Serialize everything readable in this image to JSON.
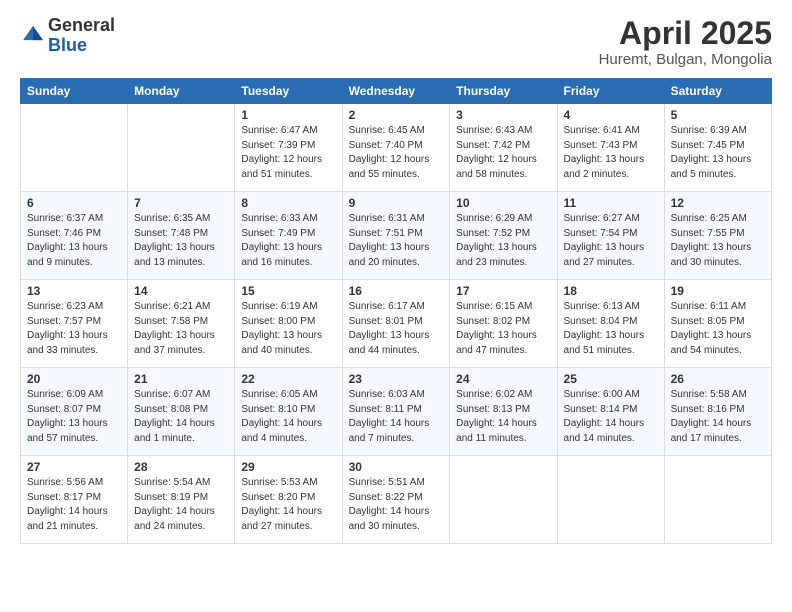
{
  "logo": {
    "general": "General",
    "blue": "Blue"
  },
  "title": "April 2025",
  "location": "Huremt, Bulgan, Mongolia",
  "days_of_week": [
    "Sunday",
    "Monday",
    "Tuesday",
    "Wednesday",
    "Thursday",
    "Friday",
    "Saturday"
  ],
  "weeks": [
    [
      {
        "day": "",
        "info": ""
      },
      {
        "day": "",
        "info": ""
      },
      {
        "day": "1",
        "info": "Sunrise: 6:47 AM\nSunset: 7:39 PM\nDaylight: 12 hours and 51 minutes."
      },
      {
        "day": "2",
        "info": "Sunrise: 6:45 AM\nSunset: 7:40 PM\nDaylight: 12 hours and 55 minutes."
      },
      {
        "day": "3",
        "info": "Sunrise: 6:43 AM\nSunset: 7:42 PM\nDaylight: 12 hours and 58 minutes."
      },
      {
        "day": "4",
        "info": "Sunrise: 6:41 AM\nSunset: 7:43 PM\nDaylight: 13 hours and 2 minutes."
      },
      {
        "day": "5",
        "info": "Sunrise: 6:39 AM\nSunset: 7:45 PM\nDaylight: 13 hours and 5 minutes."
      }
    ],
    [
      {
        "day": "6",
        "info": "Sunrise: 6:37 AM\nSunset: 7:46 PM\nDaylight: 13 hours and 9 minutes."
      },
      {
        "day": "7",
        "info": "Sunrise: 6:35 AM\nSunset: 7:48 PM\nDaylight: 13 hours and 13 minutes."
      },
      {
        "day": "8",
        "info": "Sunrise: 6:33 AM\nSunset: 7:49 PM\nDaylight: 13 hours and 16 minutes."
      },
      {
        "day": "9",
        "info": "Sunrise: 6:31 AM\nSunset: 7:51 PM\nDaylight: 13 hours and 20 minutes."
      },
      {
        "day": "10",
        "info": "Sunrise: 6:29 AM\nSunset: 7:52 PM\nDaylight: 13 hours and 23 minutes."
      },
      {
        "day": "11",
        "info": "Sunrise: 6:27 AM\nSunset: 7:54 PM\nDaylight: 13 hours and 27 minutes."
      },
      {
        "day": "12",
        "info": "Sunrise: 6:25 AM\nSunset: 7:55 PM\nDaylight: 13 hours and 30 minutes."
      }
    ],
    [
      {
        "day": "13",
        "info": "Sunrise: 6:23 AM\nSunset: 7:57 PM\nDaylight: 13 hours and 33 minutes."
      },
      {
        "day": "14",
        "info": "Sunrise: 6:21 AM\nSunset: 7:58 PM\nDaylight: 13 hours and 37 minutes."
      },
      {
        "day": "15",
        "info": "Sunrise: 6:19 AM\nSunset: 8:00 PM\nDaylight: 13 hours and 40 minutes."
      },
      {
        "day": "16",
        "info": "Sunrise: 6:17 AM\nSunset: 8:01 PM\nDaylight: 13 hours and 44 minutes."
      },
      {
        "day": "17",
        "info": "Sunrise: 6:15 AM\nSunset: 8:02 PM\nDaylight: 13 hours and 47 minutes."
      },
      {
        "day": "18",
        "info": "Sunrise: 6:13 AM\nSunset: 8:04 PM\nDaylight: 13 hours and 51 minutes."
      },
      {
        "day": "19",
        "info": "Sunrise: 6:11 AM\nSunset: 8:05 PM\nDaylight: 13 hours and 54 minutes."
      }
    ],
    [
      {
        "day": "20",
        "info": "Sunrise: 6:09 AM\nSunset: 8:07 PM\nDaylight: 13 hours and 57 minutes."
      },
      {
        "day": "21",
        "info": "Sunrise: 6:07 AM\nSunset: 8:08 PM\nDaylight: 14 hours and 1 minute."
      },
      {
        "day": "22",
        "info": "Sunrise: 6:05 AM\nSunset: 8:10 PM\nDaylight: 14 hours and 4 minutes."
      },
      {
        "day": "23",
        "info": "Sunrise: 6:03 AM\nSunset: 8:11 PM\nDaylight: 14 hours and 7 minutes."
      },
      {
        "day": "24",
        "info": "Sunrise: 6:02 AM\nSunset: 8:13 PM\nDaylight: 14 hours and 11 minutes."
      },
      {
        "day": "25",
        "info": "Sunrise: 6:00 AM\nSunset: 8:14 PM\nDaylight: 14 hours and 14 minutes."
      },
      {
        "day": "26",
        "info": "Sunrise: 5:58 AM\nSunset: 8:16 PM\nDaylight: 14 hours and 17 minutes."
      }
    ],
    [
      {
        "day": "27",
        "info": "Sunrise: 5:56 AM\nSunset: 8:17 PM\nDaylight: 14 hours and 21 minutes."
      },
      {
        "day": "28",
        "info": "Sunrise: 5:54 AM\nSunset: 8:19 PM\nDaylight: 14 hours and 24 minutes."
      },
      {
        "day": "29",
        "info": "Sunrise: 5:53 AM\nSunset: 8:20 PM\nDaylight: 14 hours and 27 minutes."
      },
      {
        "day": "30",
        "info": "Sunrise: 5:51 AM\nSunset: 8:22 PM\nDaylight: 14 hours and 30 minutes."
      },
      {
        "day": "",
        "info": ""
      },
      {
        "day": "",
        "info": ""
      },
      {
        "day": "",
        "info": ""
      }
    ]
  ]
}
